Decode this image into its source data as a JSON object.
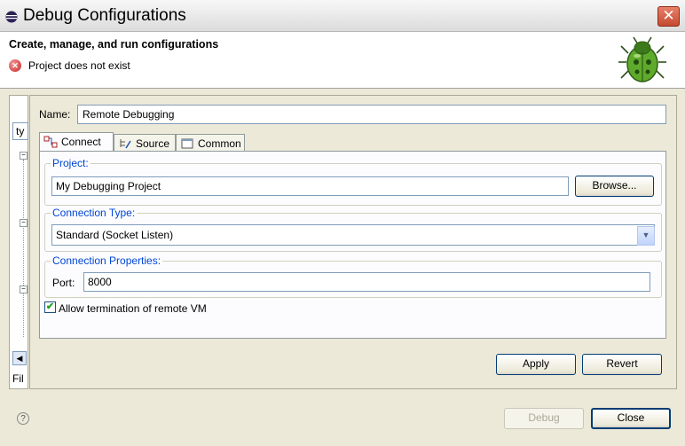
{
  "window": {
    "title": "Debug Configurations",
    "close_label": "✕"
  },
  "header": {
    "title": "Create, manage, and run configurations",
    "message": "Project does not exist",
    "error_glyph": "✕"
  },
  "left": {
    "filter_value": "ty",
    "filter_label": "Fil",
    "scroll_left_glyph": "◀"
  },
  "config": {
    "name_label": "Name:",
    "name_value": "Remote Debugging",
    "tabs": [
      {
        "label": "Connect",
        "icon": "connect-icon"
      },
      {
        "label": "Source",
        "icon": "source-icon"
      },
      {
        "label": "Common",
        "icon": "common-icon"
      }
    ],
    "project": {
      "group_title": "Project:",
      "value": "My Debugging Project",
      "browse_label": "Browse..."
    },
    "connection_type": {
      "group_title": "Connection Type:",
      "selected": "Standard (Socket Listen)"
    },
    "connection_properties": {
      "group_title": "Connection Properties:",
      "port_label": "Port:",
      "port_value": "8000"
    },
    "allow_termination": {
      "label": "Allow termination of remote VM",
      "checked": true
    }
  },
  "buttons": {
    "apply": "Apply",
    "revert": "Revert",
    "debug": "Debug",
    "close": "Close"
  },
  "colors": {
    "group_title": "#0046d5",
    "close_red": "#c44a31",
    "check_green": "#21a121"
  }
}
